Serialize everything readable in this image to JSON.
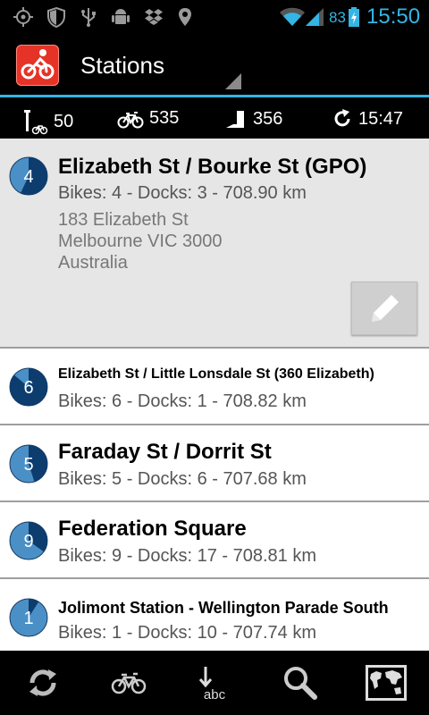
{
  "status_bar": {
    "icons": [
      "gps-icon",
      "shield-icon",
      "usb-icon",
      "android-debug-icon",
      "dropbox-icon",
      "location-pin-icon",
      "wifi-icon",
      "signal-icon",
      "battery-charging-icon"
    ],
    "battery": "83",
    "time": "15:50"
  },
  "action_bar": {
    "title": "Stations",
    "app_icon": "bike-app-icon"
  },
  "stats": {
    "stations": "50",
    "bikes": "535",
    "docks": "356",
    "updated": "15:47"
  },
  "stations": [
    {
      "count": "4",
      "fill": 0.57,
      "name": "Elizabeth St / Bourke St (GPO)",
      "info": "Bikes: 4 - Docks: 3 - 708.90 km",
      "address": [
        "183 Elizabeth St",
        "Melbourne VIC 3000",
        "Australia"
      ],
      "selected": true
    },
    {
      "count": "6",
      "fill": 0.86,
      "name": "Elizabeth St / Little Lonsdale St (360 Elizabeth)",
      "info": "Bikes: 6 - Docks: 1 - 708.82 km"
    },
    {
      "count": "5",
      "fill": 0.45,
      "name": "Faraday St / Dorrit St",
      "info": "Bikes: 5 - Docks: 6 - 707.68 km"
    },
    {
      "count": "9",
      "fill": 0.35,
      "name": "Federation Square",
      "info": "Bikes: 9 - Docks: 17 - 708.81 km"
    },
    {
      "count": "1",
      "fill": 0.09,
      "name": "Jolimont Station - Wellington Parade South",
      "info": "Bikes: 1 - Docks: 10 - 707.74 km"
    }
  ],
  "bottom_bar": [
    "refresh-icon",
    "bike-icon",
    "sort-abc-icon",
    "search-icon",
    "map-icon"
  ],
  "colors": {
    "accent": "#33b5e5",
    "badge_fill": "#0d3c6e",
    "badge_empty": "#4a90c6",
    "app_red": "#e53327"
  }
}
